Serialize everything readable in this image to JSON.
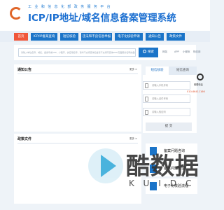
{
  "header": {
    "subtitle": "工 业 和 信 息 化 部 政 务 服 务 平 台",
    "title": "ICP/IP地址/域名信息备案管理系统"
  },
  "nav": {
    "items": [
      {
        "label": "首页",
        "active": true
      },
      {
        "label": "ICP/IP备案查询",
        "active": false
      },
      {
        "label": "短信核验",
        "active": false
      },
      {
        "label": "违法和不良信息举报",
        "active": false
      },
      {
        "label": "电子化核验申请",
        "active": false
      },
      {
        "label": "通知公告",
        "active": false
      },
      {
        "label": "政策文件",
        "active": false
      }
    ]
  },
  "search": {
    "placeholder": "请输入单位名称、域名、备案号或APP、小程序、快应用名称，暂时不支持查询包含暂不支持同查询Web页面服务名称的备案内容",
    "button_label": "搜索",
    "platforms": [
      "网站",
      "APP",
      "小程序",
      "快应用"
    ]
  },
  "notice": {
    "title": "通知公告",
    "more": "更多 >"
  },
  "policy": {
    "title": "政策文件",
    "more": "更多 >"
  },
  "login": {
    "tab_sms": "短信核验",
    "tab_query": "短信查询",
    "phone_placeholder": "请输入手机号码",
    "id_placeholder": "请输入证件号码",
    "code_placeholder": "请输入验证码",
    "submit_label": "提 交"
  },
  "side": {
    "label": "受理电话",
    "tel": "010-66411166"
  },
  "cards": [
    {
      "label": "备案问题咨询"
    },
    {
      "label": "备案问题处理"
    },
    {
      "label": "电子化核验流程"
    }
  ],
  "watermark": {
    "text": "酷数据",
    "sub": "KUIDC"
  },
  "colors": {
    "brand": "#1b74c8",
    "active_nav": "#f0563a",
    "accent": "#e0542f"
  }
}
